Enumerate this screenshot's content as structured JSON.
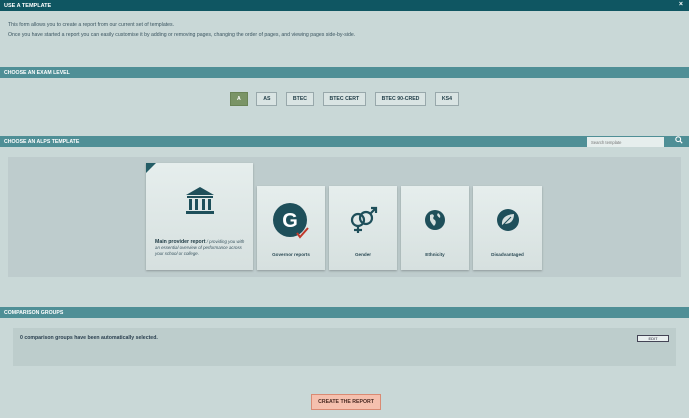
{
  "dialog": {
    "title": "USE A TEMPLATE",
    "close": "×"
  },
  "intro": {
    "line1": "This form allows you to create a report from our current set of templates.",
    "line2": "Once you have started a report you can easily customise it by adding or removing pages, changing the order of pages, and viewing pages side-by-side."
  },
  "exam_level": {
    "heading": "CHOOSE AN EXAM LEVEL",
    "levels": [
      "A",
      "AS",
      "BTEC",
      "BTEC CERT",
      "BTEC 90-CRED",
      "KS4"
    ],
    "selected": "A"
  },
  "alps_template": {
    "heading": "CHOOSE AN ALPS TEMPLATE",
    "search_placeholder": "Search template",
    "main": {
      "title": "Main provider report",
      "description": "/ providing you with an essential overview of performance across your school or college."
    },
    "cards": [
      "Governor reports",
      "Gender",
      "Ethnicity",
      "Disadvantaged"
    ]
  },
  "comparison": {
    "heading": "COMPARISON GROUPS",
    "status": "0 comparison groups have been automatically selected.",
    "edit_label": "EDIT"
  },
  "create_label": "CREATE THE REPORT",
  "colors": {
    "titlebar": "#0f5662",
    "section": "#4f8f96",
    "accent_green": "#7a9466",
    "create": "#f5c0ae"
  }
}
